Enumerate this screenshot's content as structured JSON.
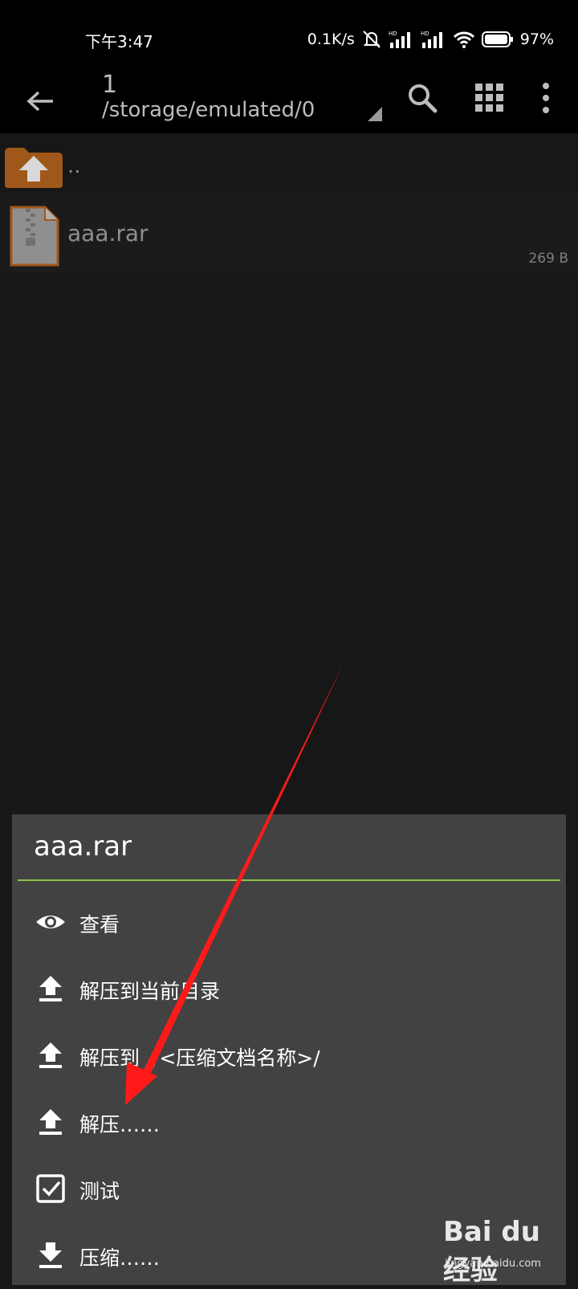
{
  "status_bar": {
    "time": "下午3:47",
    "net_speed": "0.1K/s",
    "battery": "97%",
    "icons": [
      "mute-icon",
      "hd-signal-icon",
      "hd-signal-icon",
      "wifi-icon",
      "battery-icon"
    ]
  },
  "toolbar": {
    "title": "1",
    "path": "/storage/emulated/0",
    "icons": [
      "back-arrow-icon",
      "dropdown-caret-icon",
      "search-icon",
      "grid-view-icon",
      "more-vert-icon"
    ]
  },
  "files": {
    "up_label": "..",
    "items": [
      {
        "name": "aaa.rar",
        "size": "269 B",
        "icon": "archive-icon"
      }
    ]
  },
  "context_menu": {
    "title": "aaa.rar",
    "accent_color": "#8bc34a",
    "items": [
      {
        "label": "查看",
        "icon": "eye-icon"
      },
      {
        "label": "解压到当前目录",
        "icon": "upload-icon"
      },
      {
        "label": "解压到 ./<压缩文档名称>/",
        "icon": "upload-icon"
      },
      {
        "label": "解压……",
        "icon": "upload-icon"
      },
      {
        "label": "测试",
        "icon": "checkbox-icon"
      },
      {
        "label": "压缩……",
        "icon": "download-icon"
      }
    ]
  },
  "annotation": {
    "arrow_color": "#ff1a1a"
  },
  "watermark": {
    "brand": "Bai du 经验",
    "url": "jingyan.baidu.com"
  }
}
